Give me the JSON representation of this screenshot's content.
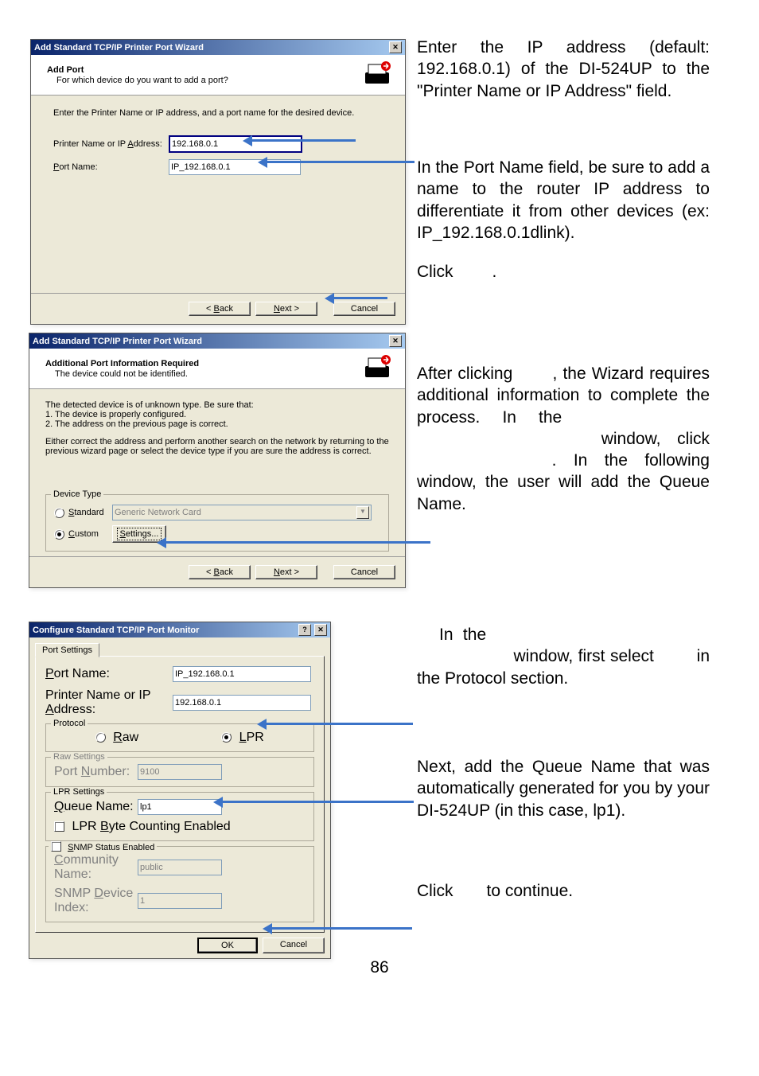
{
  "page_number": "86",
  "dialog1": {
    "title": "Add Standard TCP/IP Printer Port Wizard",
    "head_title": "Add Port",
    "head_sub": "For which device do you want to add a port?",
    "instruction": "Enter the Printer Name or IP address, and a port name for the desired device.",
    "label_printer": "Printer Name or IP ",
    "label_printer_u": "A",
    "label_printer_2": "ddress:",
    "value_printer": "192.168.0.1",
    "label_port_u": "P",
    "label_port": "ort Name:",
    "value_port": "IP_192.168.0.1",
    "back_u": "B",
    "back": "ack",
    "next_u": "N",
    "next": "ext >",
    "cancel": "Cancel"
  },
  "dialog2": {
    "title": "Add Standard TCP/IP Printer Port Wizard",
    "head_title": "Additional Port Information Required",
    "head_sub": "The device could not be identified.",
    "para1": "The detected device is of unknown type.  Be sure that:",
    "para1a": "1.  The device is properly configured.",
    "para1b": "2.  The address on the previous page is correct.",
    "para2": "Either correct the address and perform another search on the network by returning to the previous wizard page or select the device type if you are sure the address is correct.",
    "group_label": "Device Type",
    "radio_std_u": "S",
    "radio_std": "tandard",
    "std_value": "Generic Network Card",
    "radio_custom_u": "C",
    "radio_custom": "ustom",
    "settings_u": "S",
    "settings": "ettings...",
    "back_u": "B",
    "back": "ack",
    "next_u": "N",
    "next": "ext >",
    "cancel": "Cancel"
  },
  "dialog3": {
    "title": "Configure Standard TCP/IP Port Monitor",
    "tab": "Port Settings",
    "label_port_u": "P",
    "label_port": "ort Name:",
    "value_port": "IP_192.168.0.1",
    "label_printer": "Printer Name or IP ",
    "label_printer_u": "A",
    "label_printer_2": "ddress:",
    "value_printer": "192.168.0.1",
    "proto_label": "Protocol",
    "radio_raw_u": "R",
    "radio_raw": "aw",
    "radio_lpr_u": "L",
    "radio_lpr": "PR",
    "raw_group": "Raw Settings",
    "raw_portnum_u": "N",
    "raw_portnum": "umber:",
    "raw_port_pre": "Port ",
    "raw_value": "9100",
    "lpr_group": "LPR Settings",
    "lpr_queue_u": "Q",
    "lpr_queue": "ueue Name:",
    "lpr_value": "lp1",
    "lpr_byte_pre": "LPR ",
    "lpr_byte_u": "B",
    "lpr_byte": "yte Counting Enabled",
    "snmp_u": "S",
    "snmp": "NMP Status Enabled",
    "community_u": "C",
    "community": "ommunity Name:",
    "community_val": "public",
    "device_pre": "SNMP ",
    "device_u": "D",
    "device": "evice Index:",
    "device_val": "1",
    "ok": "OK",
    "cancel": "Cancel"
  },
  "text": {
    "p1": "Enter the IP address (default: 192.168.0.1) of the DI-524UP to the \"Printer Name or IP Address\" field.",
    "p2": "In the Port Name field, be sure to add a name to the router IP address to differentiate it from other devices (ex: IP_192.168.0.1dlink).",
    "p3_pre": "Click ",
    "p3_post": ".",
    "p4": "After clicking , the Wizard requires additional information to complete the process. In the  window, click . In the following window, the user will add the Queue Name.",
    "p5_a": "In the ",
    "p5_b": " window, first select ",
    "p5_c": " in the Protocol section.",
    "p6": "Next, add the Queue Name that was automatically generated for you by your DI-524UP (in this case, lp1).",
    "p7_pre": "Click ",
    "p7_post": " to continue."
  }
}
